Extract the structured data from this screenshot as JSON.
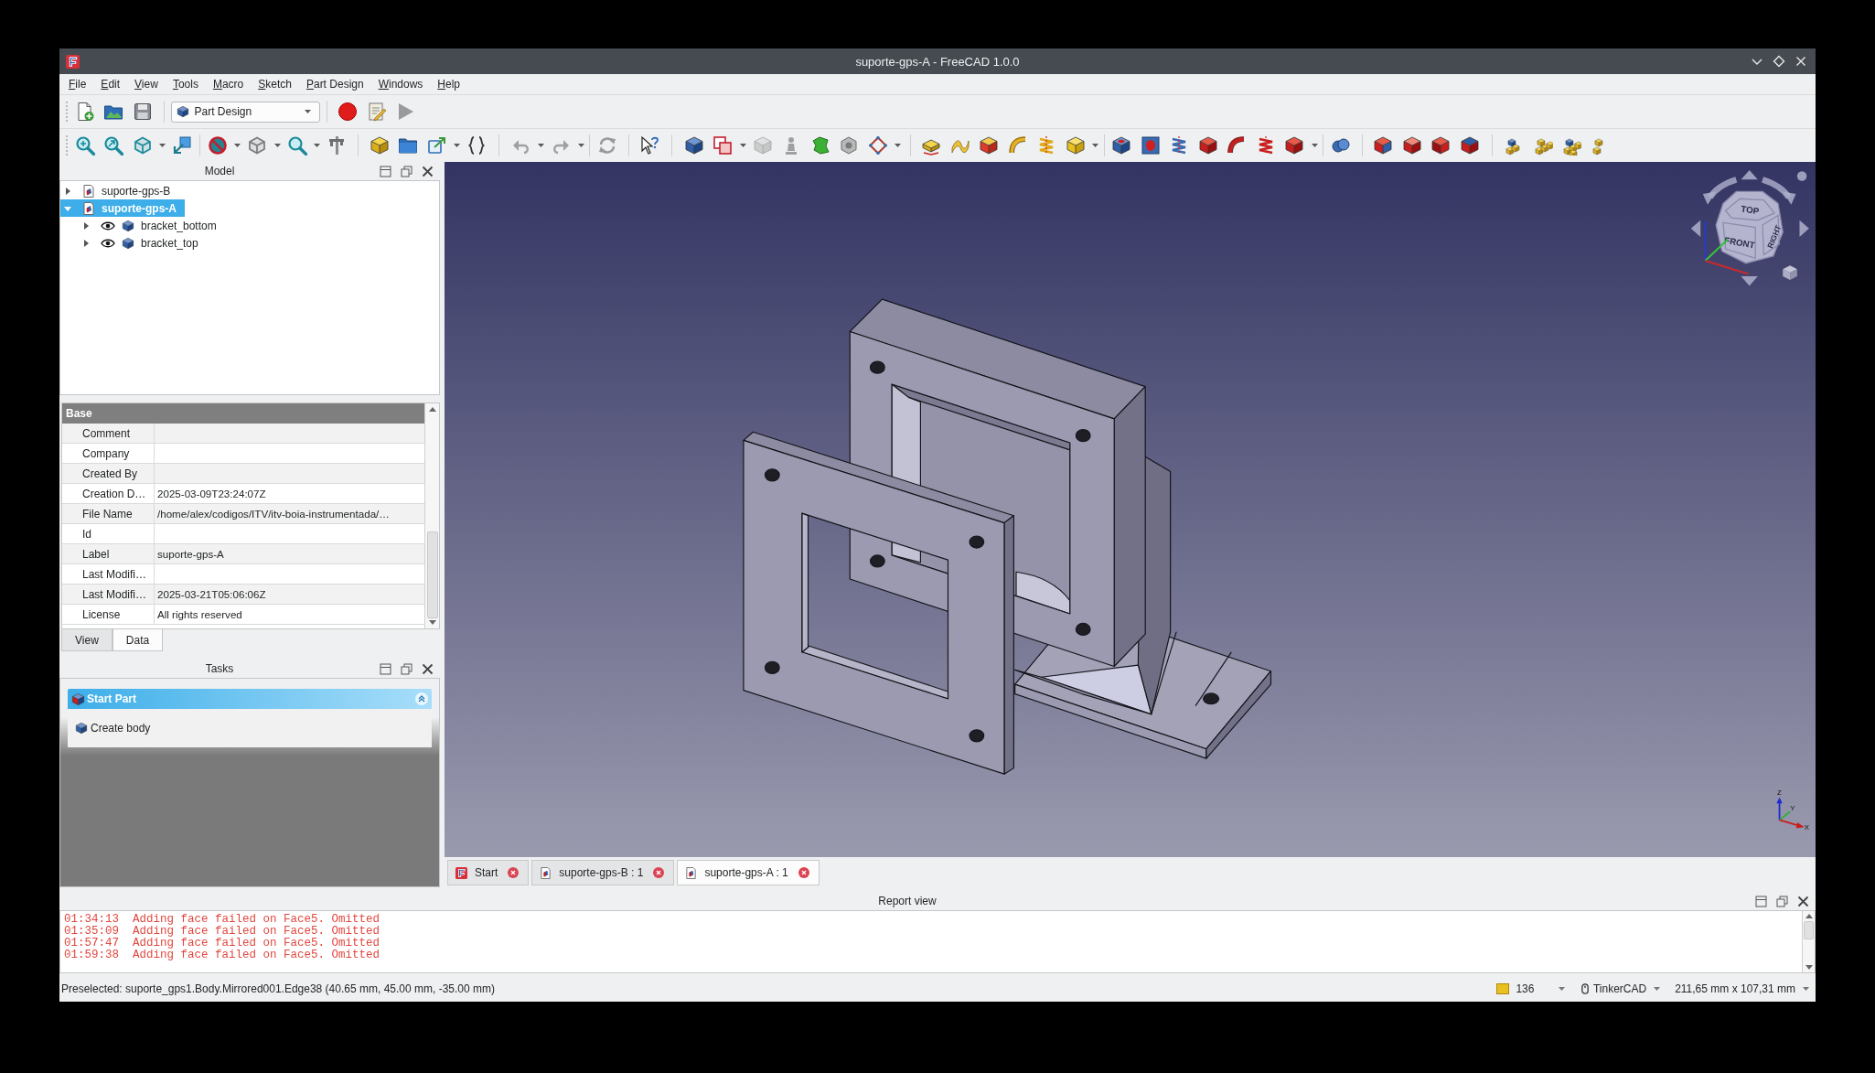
{
  "window": {
    "title": "suporte-gps-A - FreeCAD 1.0.0"
  },
  "menu": [
    "File",
    "Edit",
    "View",
    "Tools",
    "Macro",
    "Sketch",
    "Part Design",
    "Windows",
    "Help"
  ],
  "toolbar": {
    "workbench": "Part Design"
  },
  "model_panel": {
    "title": "Model",
    "tree": [
      {
        "label": "suporte-gps-B",
        "kind": "document",
        "expanded": false,
        "selected": false
      },
      {
        "label": "suporte-gps-A",
        "kind": "document",
        "expanded": true,
        "selected": true,
        "children": [
          {
            "label": "bracket_bottom",
            "kind": "body",
            "expanded": false,
            "selected": false,
            "visible": true
          },
          {
            "label": "bracket_top",
            "kind": "body",
            "expanded": false,
            "selected": false,
            "visible": true
          }
        ]
      }
    ]
  },
  "property_view": {
    "group": "Base",
    "rows": [
      {
        "name": "Comment"
      },
      {
        "name": "Company"
      },
      {
        "name": "Created By"
      },
      {
        "name": "Creation D…",
        "value": "2025-03-09T23:24:07Z"
      },
      {
        "name": "File Name",
        "value": "/home/alex/codigos/ITV/itv-boia-instrumentada/…"
      },
      {
        "name": "Id"
      },
      {
        "name": "Label",
        "value": "suporte-gps-A"
      },
      {
        "name": "Last Modifi…"
      },
      {
        "name": "Last Modifi…",
        "value": "2025-03-21T05:06:06Z"
      },
      {
        "name": "License",
        "value": "All rights reserved"
      }
    ],
    "tabs": [
      {
        "label": "View",
        "selected": false
      },
      {
        "label": "Data",
        "selected": true
      }
    ]
  },
  "tasks_panel": {
    "title": "Tasks",
    "sections": [
      {
        "title": "Start Part",
        "expanded": true,
        "items": [
          "Create body"
        ]
      }
    ]
  },
  "viewport": {
    "nav_cube_faces": [
      "TOP",
      "FRONT",
      "RIGHT"
    ],
    "axis_labels": [
      "Z",
      "Y",
      "X"
    ]
  },
  "document_tabs": [
    {
      "label": "Start",
      "kind": "start",
      "selected": false
    },
    {
      "label": "suporte-gps-B : 1",
      "kind": "document",
      "selected": false
    },
    {
      "label": "suporte-gps-A : 1",
      "kind": "document",
      "selected": true
    }
  ],
  "report_view": {
    "title": "Report view",
    "lines": [
      {
        "text": "01:34:13  Adding face failed on Face5. Omitted",
        "kind": "error"
      },
      {
        "text": "01:35:09  Adding face failed on Face5. Omitted",
        "kind": "error"
      },
      {
        "text": "01:57:47  Adding face failed on Face5. Omitted",
        "kind": "error"
      },
      {
        "text": "01:59:38  Adding face failed on Face5. Omitted",
        "kind": "error"
      }
    ]
  },
  "status_bar": {
    "message": "Preselected: suporte_gps1.Body.Mirrored001.Edge38 (40.65 mm, 45.00 mm, -35.00 mm)",
    "count": "136",
    "navigation_style": "TinkerCAD",
    "dimensions": "211,65 mm x 107,31 mm"
  }
}
